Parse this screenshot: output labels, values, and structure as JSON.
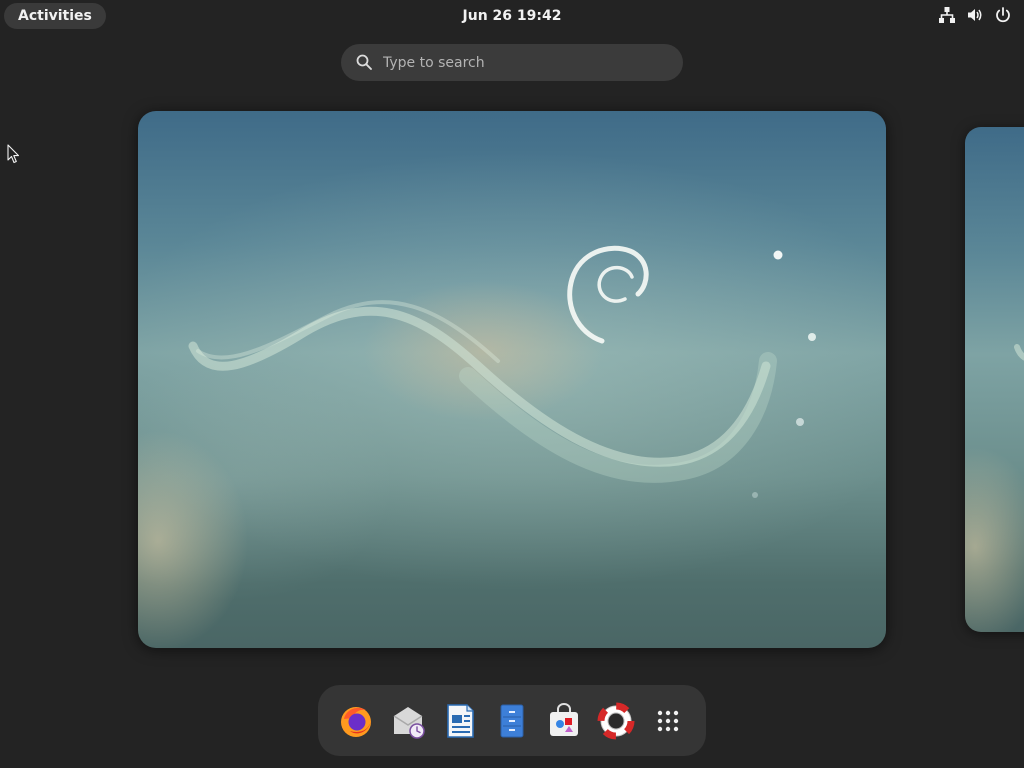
{
  "topbar": {
    "activities_label": "Activities",
    "clock": "Jun 26  19:42",
    "status_icons": [
      "network-icon",
      "volume-icon",
      "power-icon"
    ]
  },
  "search": {
    "placeholder": "Type to search",
    "value": ""
  },
  "workspaces": {
    "current": "workspace-1",
    "wallpaper": "debian-swirl"
  },
  "dock": {
    "items": [
      {
        "name": "firefox-icon",
        "label": "Firefox"
      },
      {
        "name": "evolution-icon",
        "label": "Evolution"
      },
      {
        "name": "libreoffice-writer-icon",
        "label": "LibreOffice Writer"
      },
      {
        "name": "file-manager-icon",
        "label": "Files"
      },
      {
        "name": "software-icon",
        "label": "Software"
      },
      {
        "name": "help-icon",
        "label": "Help"
      },
      {
        "name": "show-apps-icon",
        "label": "Show Applications"
      }
    ]
  },
  "colors": {
    "panel_bg": "#232323",
    "pill_bg": "#3a3a3a",
    "dock_bg": "#353535",
    "text": "#f2f2f2"
  }
}
